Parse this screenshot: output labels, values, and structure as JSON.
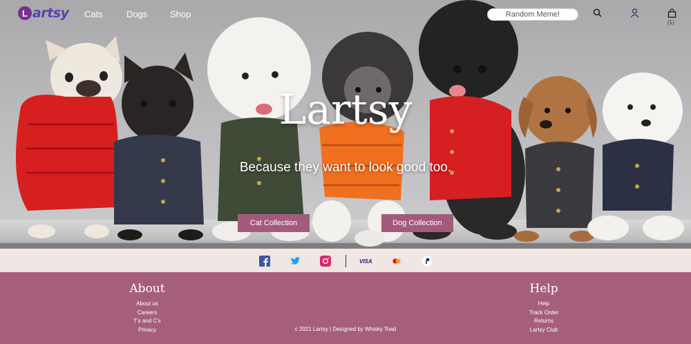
{
  "nav": {
    "logo_letter": "L",
    "logo_text": "artsy",
    "links": [
      "Cats",
      "Dogs",
      "Shop"
    ],
    "random_meme_label": "Random Meme!",
    "cart_count": "(1)",
    "icons": [
      "search-icon",
      "user-icon",
      "bag-icon"
    ]
  },
  "hero": {
    "title": "Lartsy",
    "subtitle": "Because they want to look good too.",
    "cat_button": "Cat Collection",
    "dog_button": "Dog Collection"
  },
  "social": {
    "icons": [
      "facebook-icon",
      "twitter-icon",
      "instagram-icon"
    ],
    "payments": [
      "VISA",
      "mastercard-icon",
      "paypal-icon"
    ],
    "visa_label": "VISA"
  },
  "footer": {
    "about": {
      "title": "About",
      "links": [
        "About us",
        "Careers",
        "T's and C's",
        "Privacy"
      ]
    },
    "help": {
      "title": "Help",
      "links": [
        "Help",
        "Track Order",
        "Returns",
        "Lartsy Club"
      ]
    },
    "copyright": "c 2021 Lartsy | Designed by Whisky Toad"
  },
  "colors": {
    "accent": "#a35a7c",
    "footer_bg": "#a55f7d",
    "social_bg": "#f0e6e4",
    "logo_purple": "#7b2f8e"
  }
}
